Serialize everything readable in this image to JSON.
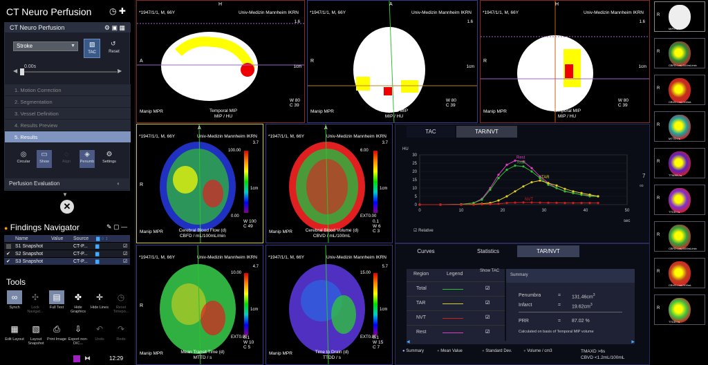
{
  "app": {
    "title": "CT Neuro Perfusion"
  },
  "workflow": {
    "title": "CT Neuro Perfusion",
    "mode": "Stroke",
    "tac_label": "TAC",
    "reset_label": "Reset",
    "time_value": "0.00s",
    "steps": [
      "1. Motion Correction",
      "2. Segmentation",
      "3. Vessel Definition",
      "4. Results Preview",
      "5. Results"
    ],
    "active_step": 4,
    "tool_buttons": [
      "Circular",
      "Show",
      "Align",
      "Penumb",
      "Settings"
    ],
    "perfusion_eval": "Perfusion Evaluation"
  },
  "findings": {
    "title": "Findings Navigator",
    "columns": [
      "Name",
      "Value",
      "Source"
    ],
    "rows": [
      {
        "name": "S1 Snapshot",
        "source": "CT-P...",
        "checked": false
      },
      {
        "name": "S2 Snapshot",
        "source": "CT-P...",
        "checked": true
      },
      {
        "name": "S3 Snapshot",
        "source": "CT-P...",
        "checked": true
      }
    ]
  },
  "tools": {
    "title": "Tools",
    "items": [
      "Synch",
      "Lock Navigat...",
      "Full Text",
      "Hide Graphics",
      "Hide Lines",
      "Reset Timepo...",
      "Edit Layout",
      "Layout Snapshot",
      "Print Image",
      "Export non-DIC...",
      "Undo",
      "Redo"
    ],
    "clock": "12:29"
  },
  "viewports": {
    "patient": "*1947/1/1, M, 66Y",
    "institution": "Univ-Medizin Mannheim IKRN",
    "manip": "Manip MPR",
    "top": [
      {
        "orient_left": "A",
        "orient_top": "H",
        "zoom": "1.6",
        "label": "Temporal MIP\nMIP / HU",
        "w": "80",
        "c": "39"
      },
      {
        "orient_left": "R",
        "orient_top": "A",
        "zoom": "1.6",
        "label": "Temporal MIP\nMIP / HU",
        "w": "80",
        "c": "39"
      },
      {
        "orient_left": "R",
        "orient_top": "H",
        "zoom": "1.6",
        "label": "Temporal MIP\nMIP / HU",
        "w": "80",
        "c": "39"
      }
    ],
    "maps": [
      {
        "zoom": "3.7",
        "label": "Cerebral Blood Flow (d)\nCBFD / mL/100mL/min",
        "bar_top": "100.00",
        "bar_bottom": "0.00",
        "w": "100",
        "c": "49"
      },
      {
        "zoom": "3.7",
        "label": "Cerebral Blood Volume (d)\nCBVD / mL/100mL",
        "bar_top": "6.00",
        "bar_bottom": "0.00",
        "w": "6",
        "c": "3"
      },
      {
        "zoom": "4.7",
        "label": "Mean Transit Time (d)\nMTTD / s",
        "bar_top": "10.00",
        "bar_bottom": "0.00",
        "w": "10",
        "c": "5"
      },
      {
        "zoom": "5.7",
        "label": "Time to Drain (d)\nTTDD / s",
        "bar_top": "15.00",
        "bar_bottom": "0.00",
        "w": "15",
        "c": "7"
      }
    ],
    "ext_label": "EXT",
    "ext_value": "0.1",
    "cm": "1cm"
  },
  "chart_data": {
    "type": "line",
    "tabs": [
      "TAC",
      "TAR/NVT"
    ],
    "ylabel": "HU",
    "xunit": "sec",
    "ylim": [
      0,
      30
    ],
    "xlim": [
      0,
      50
    ],
    "yticks": [
      0,
      5,
      10,
      15,
      20,
      25,
      30
    ],
    "xticks": [
      0,
      10,
      20,
      30,
      40,
      50
    ],
    "side_value": "7",
    "relative_label": "Relative",
    "series": [
      {
        "name": "Rest",
        "color": "#e040c0",
        "x": [
          0,
          5,
          10,
          13,
          15,
          17,
          19,
          21,
          23,
          25,
          27,
          29,
          31,
          33,
          35,
          37,
          39,
          41,
          43
        ],
        "y": [
          0,
          0,
          0.2,
          1,
          3.5,
          10,
          18,
          24,
          26.5,
          26,
          22,
          17,
          13,
          10,
          8,
          7,
          6,
          5.5,
          5
        ]
      },
      {
        "name": "Total",
        "color": "#30c030",
        "x": [
          0,
          5,
          10,
          13,
          15,
          17,
          19,
          21,
          23,
          25,
          27,
          29,
          31,
          33,
          35,
          37,
          39,
          41,
          43
        ],
        "y": [
          0,
          0,
          0.2,
          1,
          3,
          9,
          16,
          21,
          23.5,
          23,
          20,
          16,
          12,
          10,
          8,
          7,
          6,
          5,
          5
        ]
      },
      {
        "name": "TAR",
        "color": "#e0d020",
        "x": [
          0,
          5,
          10,
          13,
          15,
          17,
          19,
          21,
          23,
          25,
          27,
          29,
          31,
          33,
          35,
          37,
          39,
          41,
          43
        ],
        "y": [
          0,
          0,
          0,
          0.2,
          0.5,
          1,
          2.5,
          5,
          8,
          11,
          13.5,
          14.5,
          13,
          11.5,
          9.5,
          8,
          7,
          6,
          5
        ]
      },
      {
        "name": "NVT",
        "color": "#d02020",
        "x": [
          0,
          5,
          10,
          13,
          15,
          17,
          19,
          21,
          23,
          25,
          27,
          29,
          31,
          33,
          35,
          37,
          39,
          41,
          43
        ],
        "y": [
          0,
          0,
          0,
          0,
          0.2,
          0.3,
          0.5,
          1,
          1.2,
          1.3,
          1.3,
          1.2,
          1.1,
          1.1,
          1,
          1,
          1,
          1,
          1
        ]
      }
    ]
  },
  "results": {
    "tabs": [
      "Curves",
      "Statistics",
      "TAR/NVT"
    ],
    "table_headers": [
      "Region",
      "Legend",
      "Show TAC"
    ],
    "regions": [
      {
        "name": "Total",
        "color": "#30c030"
      },
      {
        "name": "TAR",
        "color": "#e0d020"
      },
      {
        "name": "NVT",
        "color": "#d02020"
      },
      {
        "name": "Rest",
        "color": "#e040c0"
      }
    ],
    "summary_title": "Summary",
    "penumbra_label": "Penumbra",
    "penumbra_eq": "=",
    "penumbra_value": "131.46cm",
    "infarct_label": "Infarct",
    "infarct_eq": "=",
    "infarct_value": "19.62cm",
    "prr_label": "PRR",
    "prr_eq": "=",
    "prr_value": "87.02 %",
    "note": "Calculated on basis of Temporal MIP volume",
    "radio": [
      "Summary",
      "Mean Value",
      "Standard Dev.",
      "Volume / cm3"
    ],
    "tmax": "TMAXD >6s",
    "cbv": "CBVD <1.2mL/100mL"
  },
  "thumbnails": {
    "labels": [
      "MIP/HU",
      "CBFD / mL/100mL/min",
      "CBVD / mL/100mL",
      "MTTD / s",
      "TTMAX / s",
      "TTDD / s",
      "CBFD / mL/100mL/min",
      "CBVD / mL/100mL",
      "TTDD / s"
    ]
  }
}
